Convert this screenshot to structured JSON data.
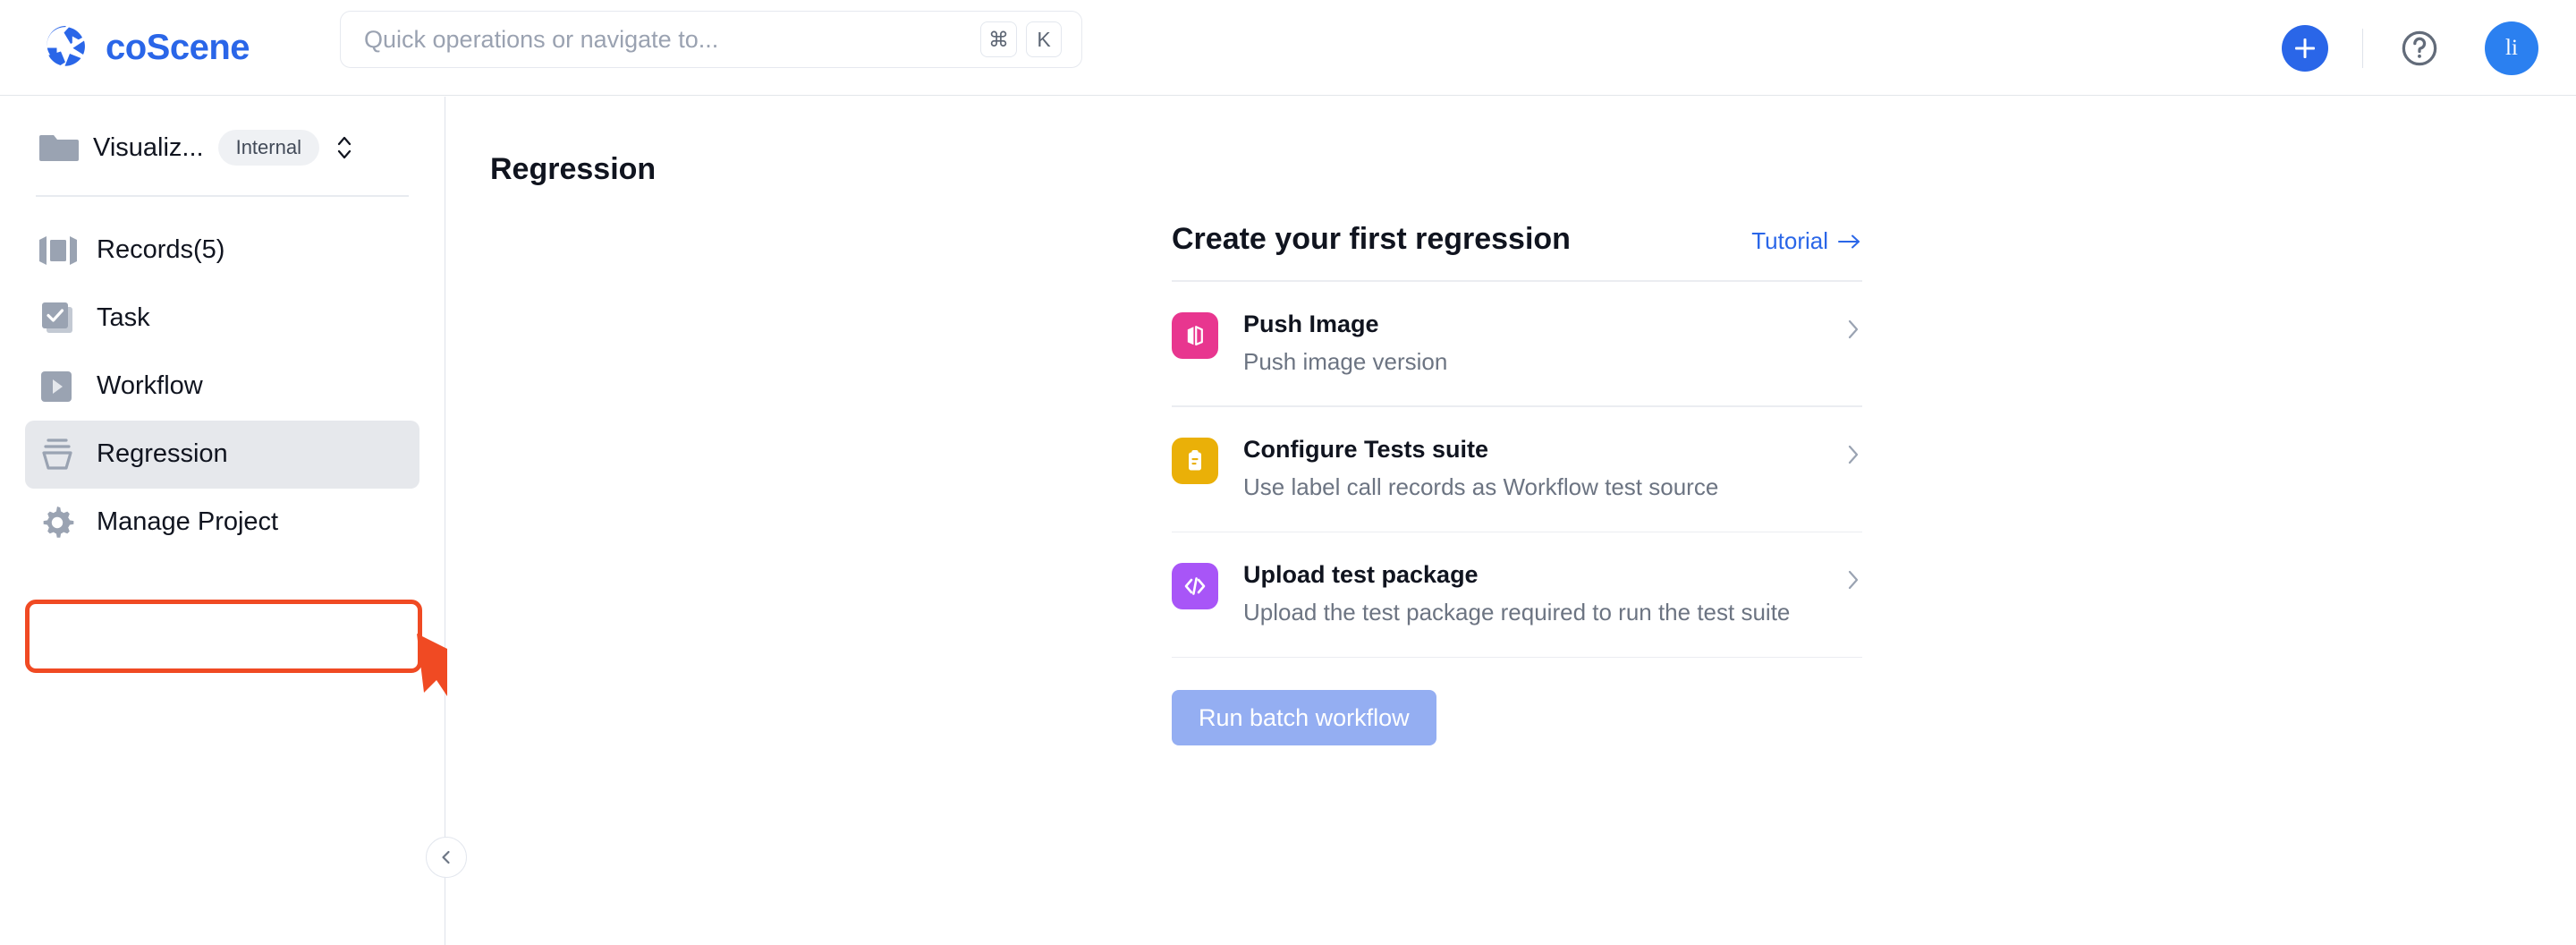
{
  "brand": {
    "name": "coScene",
    "logo_icon": "aperture-logo-icon"
  },
  "search": {
    "placeholder": "Quick operations or navigate to...",
    "value": "",
    "shortcut_keys": [
      "⌘",
      "K"
    ]
  },
  "header": {
    "add_icon": "plus-icon",
    "help_icon": "question-circle-icon",
    "avatar_initials": "li"
  },
  "sidebar": {
    "project": {
      "icon": "folder-icon",
      "name": "Visualiz...",
      "badge": "Internal",
      "selector_icon": "chevron-up-down-icon"
    },
    "items": [
      {
        "label": "Records(5)",
        "icon": "records-icon",
        "active": false
      },
      {
        "label": "Task",
        "icon": "task-check-icon",
        "active": false
      },
      {
        "label": "Workflow",
        "icon": "workflow-play-icon",
        "active": false
      },
      {
        "label": "Regression",
        "icon": "regression-funnel-icon",
        "active": true
      },
      {
        "label": "Manage Project",
        "icon": "gear-icon",
        "active": false
      }
    ],
    "collapse_icon": "chevron-left-icon"
  },
  "annotation": {
    "highlight_color": "#f04a23",
    "arrow_icon": "pointer-arrow-icon",
    "target": "Regression"
  },
  "main": {
    "page_title": "Regression",
    "card": {
      "title": "Create your first regression",
      "tutorial_label": "Tutorial",
      "tutorial_arrow_icon": "arrow-right-icon",
      "actions": [
        {
          "title": "Push Image",
          "desc": "Push image version",
          "icon": "image-book-icon",
          "icon_color": "#e8368f",
          "chevron_icon": "chevron-right-icon"
        },
        {
          "title": "Configure Tests suite",
          "desc": "Use label call records as Workflow test source",
          "icon": "clipboard-icon",
          "icon_color": "#eab008",
          "chevron_icon": "chevron-right-icon"
        },
        {
          "title": "Upload test package",
          "desc": "Upload the test package required to run the test suite",
          "icon": "code-brackets-icon",
          "icon_color": "#a855f7",
          "chevron_icon": "chevron-right-icon"
        }
      ],
      "run_button": "Run batch workflow"
    }
  },
  "colors": {
    "brand_blue": "#2a66e8",
    "avatar_blue": "#2b80f0",
    "annotation_orange": "#f04a23",
    "muted_button_blue": "#94aef2",
    "icon_gray": "#9aa3b2"
  }
}
